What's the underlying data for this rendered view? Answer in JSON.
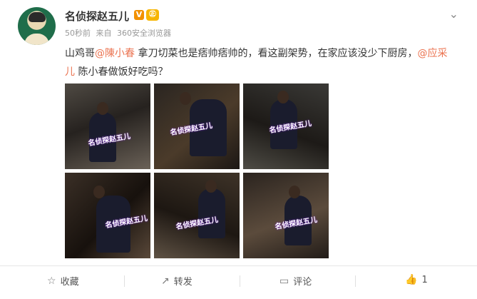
{
  "post": {
    "author": "名侦探赵五儿",
    "verified_badge": "V",
    "member_badge": "㊣",
    "time": "50秒前",
    "source_prefix": "来自",
    "source": "360安全浏览器",
    "text_part1": "山鸡哥",
    "mention1": "@陳小春",
    "text_part2": " 拿刀切菜也是痞帅痞帅的，看这副架势，在家应该没少下厨房，",
    "mention2": "@应采儿",
    "text_part3": " 陈小春做饭好吃吗？",
    "menu_icon": "chevron-down-icon",
    "watermark": "名侦探赵五儿"
  },
  "actions": {
    "favorite": "收藏",
    "repost": "转发",
    "comment": "评论",
    "like_count": "1"
  },
  "icons": {
    "favorite": "star-outline-icon",
    "repost": "repost-icon",
    "comment": "comment-icon",
    "like": "thumbs-up-icon"
  },
  "colors": {
    "mention": "#eb7350",
    "badge": "#f29100"
  }
}
